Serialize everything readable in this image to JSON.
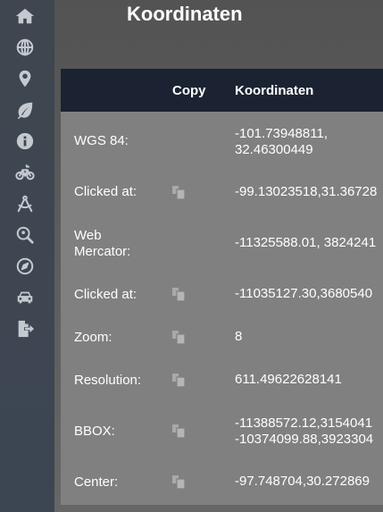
{
  "page": {
    "title": "Koordinaten"
  },
  "sidebar": {
    "items": [
      {
        "icon": "home-icon"
      },
      {
        "icon": "globe-icon"
      },
      {
        "icon": "map-marker-icon"
      },
      {
        "icon": "leaf-icon"
      },
      {
        "icon": "info-icon"
      },
      {
        "icon": "bicycle-icon"
      },
      {
        "icon": "drafting-compass-icon"
      },
      {
        "icon": "search-location-icon"
      },
      {
        "icon": "compass-icon"
      },
      {
        "icon": "car-icon"
      },
      {
        "icon": "file-export-icon"
      }
    ]
  },
  "table": {
    "headers": {
      "copy": "Copy",
      "coords": "Koordinaten"
    },
    "rows": [
      {
        "label": "WGS 84:",
        "value_line1": "-101.73948811,",
        "value_line2": "32.46300449",
        "copy": false
      },
      {
        "label": "Clicked at:",
        "value_line1": "-99.13023518,31.36728",
        "copy": true
      },
      {
        "label_line1": "Web",
        "label_line2": "Mercator:",
        "value_line1": "-11325588.01, 3824241",
        "copy": false
      },
      {
        "label": "Clicked at:",
        "value_line1": "-11035127.30,3680540",
        "copy": true
      },
      {
        "label": "Zoom:",
        "value_line1": "8",
        "copy": true
      },
      {
        "label": "Resolution:",
        "value_line1": "611.49622628141",
        "copy": true
      },
      {
        "label": "BBOX:",
        "value_line1": "-11388572.12,3154041",
        "value_line2": "-10374099.88,3923304",
        "copy": true
      },
      {
        "label": "Center:",
        "value_line1": "-97.748704,30.272869",
        "copy": true
      }
    ]
  },
  "colors": {
    "sidebar_bg": "#3f4650",
    "header_bg": "#1b2332",
    "panel_bg": "#808080",
    "icon": "#c4c9d0",
    "copy_icon": "#a9a9a9"
  }
}
